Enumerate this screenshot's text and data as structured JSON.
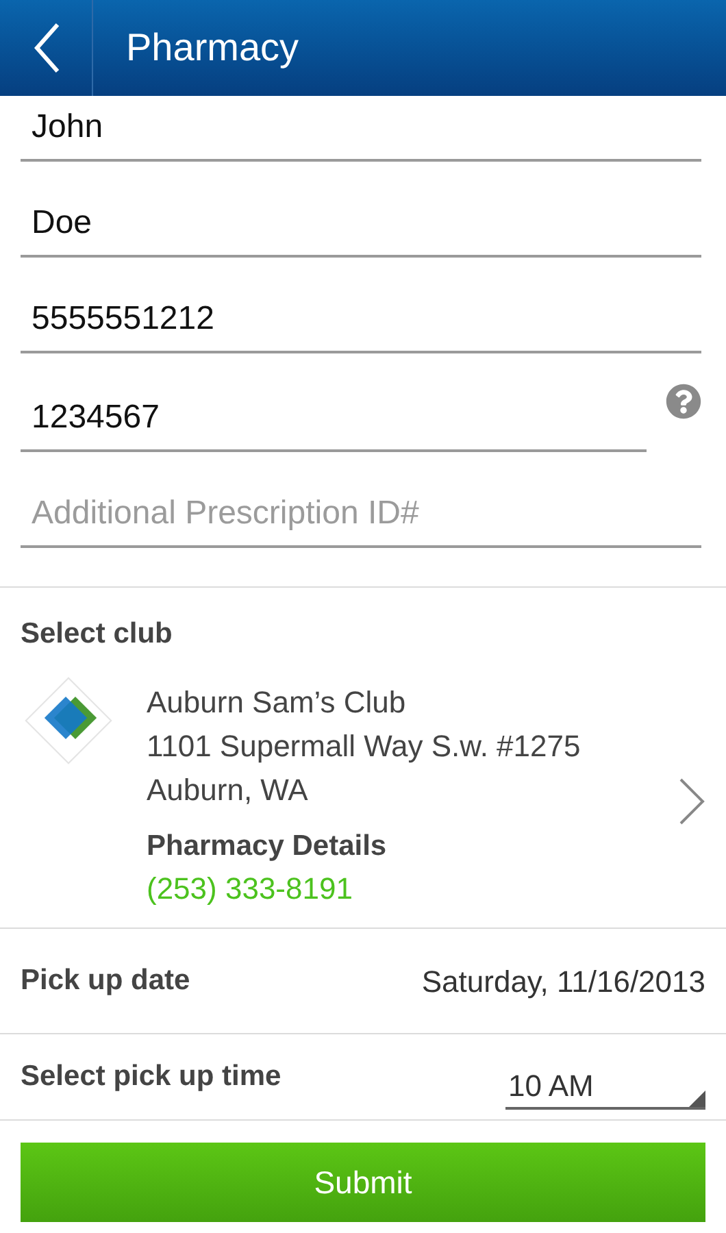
{
  "header": {
    "title": "Pharmacy"
  },
  "fields": [
    {
      "value": "John",
      "help": false
    },
    {
      "value": "Doe",
      "help": false
    },
    {
      "value": "5555551212",
      "help": false
    },
    {
      "value": "1234567",
      "help": true
    },
    {
      "placeholder": "Additional Prescription ID#",
      "help": false
    }
  ],
  "club": {
    "heading": "Select club",
    "name": "Auburn Sam’s Club",
    "address": "1101 Supermall Way S.w. #1275",
    "city": "Auburn, WA",
    "details_label": "Pharmacy Details",
    "phone": "(253) 333-8191"
  },
  "pickup_date": {
    "label": "Pick up date",
    "value": "Saturday, 11/16/2013"
  },
  "pickup_time": {
    "label": "Select pick up time",
    "value": "10 AM"
  },
  "submit": "Submit"
}
